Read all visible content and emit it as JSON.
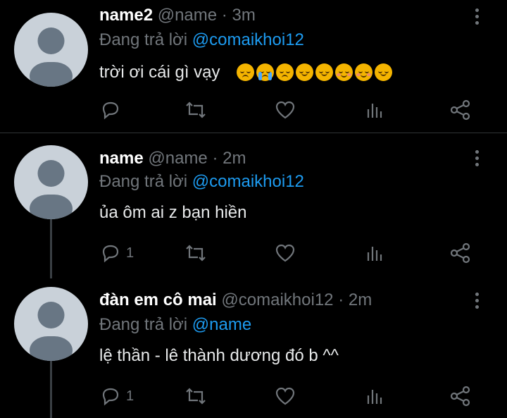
{
  "tweets": [
    {
      "name": "name2",
      "handle": "@name",
      "separator": "·",
      "time": "3m",
      "reply_prefix": "Đang trả lời",
      "reply_to": "@comaikhoi12",
      "text": "trời ơi cái gì vạy",
      "emojis": [
        "pensive-emoji",
        "loudly-crying-emoji",
        "smiling-with-tear-emoji",
        "upside-down-emoji",
        "slightly-smiling-emoji",
        "relieved-smile-emoji",
        "blush-emoji",
        "relieved-emoji"
      ],
      "reply_count": "",
      "icons": [
        "reply-icon",
        "retweet-icon",
        "like-icon",
        "analytics-icon",
        "share-icon",
        "more-icon"
      ]
    },
    {
      "name": "name",
      "handle": "@name",
      "separator": "·",
      "time": "2m",
      "reply_prefix": "Đang trả lời",
      "reply_to": "@comaikhoi12",
      "text": "ủa ôm ai z bạn hiền",
      "reply_count": "1"
    },
    {
      "name": "đàn em cô mai",
      "handle": "@comaikhoi12",
      "separator": "·",
      "time": "2m",
      "reply_prefix": "Đang trả lời",
      "reply_to": "@name",
      "text": "lệ thần - lê thành dương đó b ^^",
      "reply_count": "1"
    }
  ],
  "colors": {
    "background": "#000000",
    "muted": "#71767b",
    "mention": "#1d9bf0",
    "avatar_bg": "#c9d1d9",
    "avatar_fg": "#687684",
    "divider": "#2f3336"
  }
}
